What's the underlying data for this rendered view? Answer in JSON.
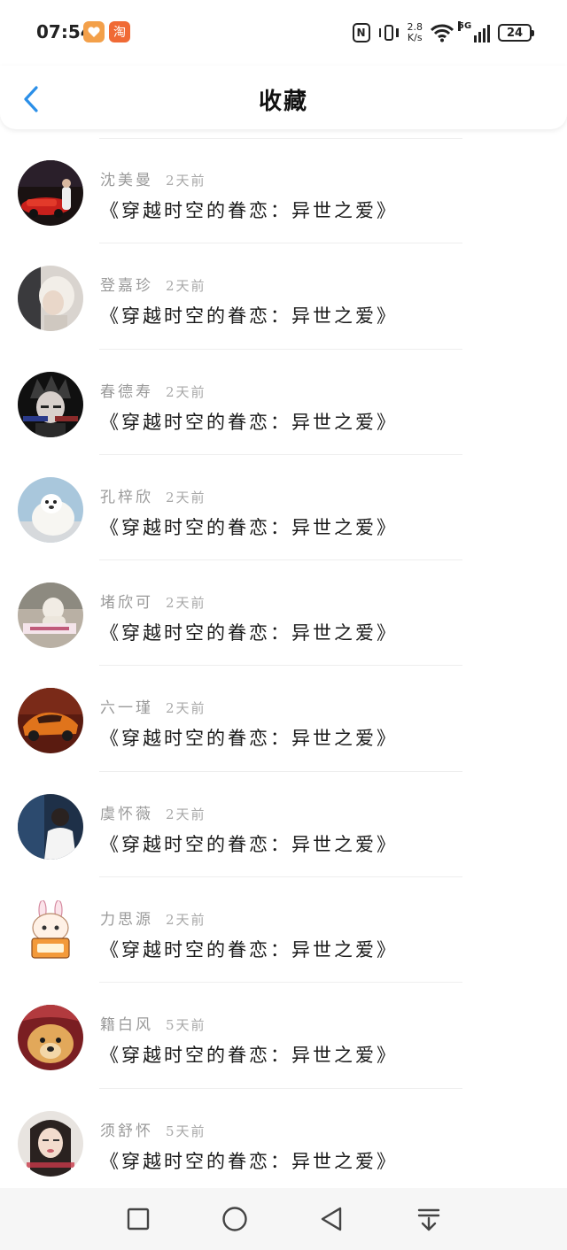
{
  "status": {
    "time": "07:54",
    "app_icon_1": "heart-app-icon",
    "app_icon_2": "淘",
    "nfc": "N",
    "speed_value": "2.8",
    "speed_unit": "K/s",
    "network": "5G",
    "battery": "24"
  },
  "header": {
    "title": "收藏",
    "back_icon": "chevron-left-icon",
    "accent": "#2b8fe8"
  },
  "items": [
    {
      "name": "沈美曼",
      "time": "2天前",
      "title": "《穿越时空的眷恋：异世之爱》"
    },
    {
      "name": "登嘉珍",
      "time": "2天前",
      "title": "《穿越时空的眷恋：异世之爱》"
    },
    {
      "name": "春德寿",
      "time": "2天前",
      "title": "《穿越时空的眷恋：异世之爱》"
    },
    {
      "name": "孔梓欣",
      "time": "2天前",
      "title": "《穿越时空的眷恋：异世之爱》"
    },
    {
      "name": "堵欣可",
      "time": "2天前",
      "title": "《穿越时空的眷恋：异世之爱》"
    },
    {
      "name": "六一瑾",
      "time": "2天前",
      "title": "《穿越时空的眷恋：异世之爱》"
    },
    {
      "name": "虞怀薇",
      "time": "2天前",
      "title": "《穿越时空的眷恋：异世之爱》"
    },
    {
      "name": "力思源",
      "time": "2天前",
      "title": "《穿越时空的眷恋：异世之爱》"
    },
    {
      "name": "籍白风",
      "time": "5天前",
      "title": "《穿越时空的眷恋：异世之爱》"
    },
    {
      "name": "须舒怀",
      "time": "5天前",
      "title": "《穿越时空的眷恋：异世之爱》"
    }
  ],
  "navbar": {
    "icons": [
      "recents-square-icon",
      "home-circle-icon",
      "back-triangle-icon",
      "notification-pulldown-icon"
    ]
  }
}
